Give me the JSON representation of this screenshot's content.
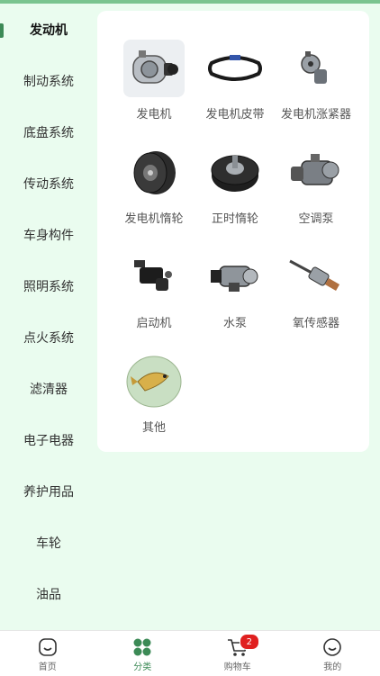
{
  "sidebar": {
    "items": [
      {
        "label": "发动机"
      },
      {
        "label": "制动系统"
      },
      {
        "label": "底盘系统"
      },
      {
        "label": "传动系统"
      },
      {
        "label": "车身构件"
      },
      {
        "label": "照明系统"
      },
      {
        "label": "点火系统"
      },
      {
        "label": "滤清器"
      },
      {
        "label": "电子电器"
      },
      {
        "label": "养护用品"
      },
      {
        "label": "车轮"
      },
      {
        "label": "油品"
      }
    ],
    "active_index": 0
  },
  "products": [
    {
      "label": "发电机",
      "icon": "alternator-image"
    },
    {
      "label": "发电机皮带",
      "icon": "belt-image"
    },
    {
      "label": "发电机涨紧器",
      "icon": "tensioner-image"
    },
    {
      "label": "发电机惰轮",
      "icon": "idler-pulley-image"
    },
    {
      "label": "正时惰轮",
      "icon": "timing-idler-image"
    },
    {
      "label": "空调泵",
      "icon": "ac-compressor-image"
    },
    {
      "label": "启动机",
      "icon": "starter-image"
    },
    {
      "label": "水泵",
      "icon": "water-pump-image"
    },
    {
      "label": "氧传感器",
      "icon": "oxygen-sensor-image"
    },
    {
      "label": "其他",
      "icon": "fish-image"
    }
  ],
  "tabbar": {
    "tabs": [
      {
        "label": "首页",
        "icon": "home-icon"
      },
      {
        "label": "分类",
        "icon": "category-icon"
      },
      {
        "label": "购物车",
        "icon": "cart-icon",
        "badge": "2"
      },
      {
        "label": "我的",
        "icon": "profile-icon"
      }
    ],
    "active_index": 1
  },
  "colors": {
    "accent": "#3c8a56",
    "background": "#eafcef",
    "badge": "#e02020"
  }
}
